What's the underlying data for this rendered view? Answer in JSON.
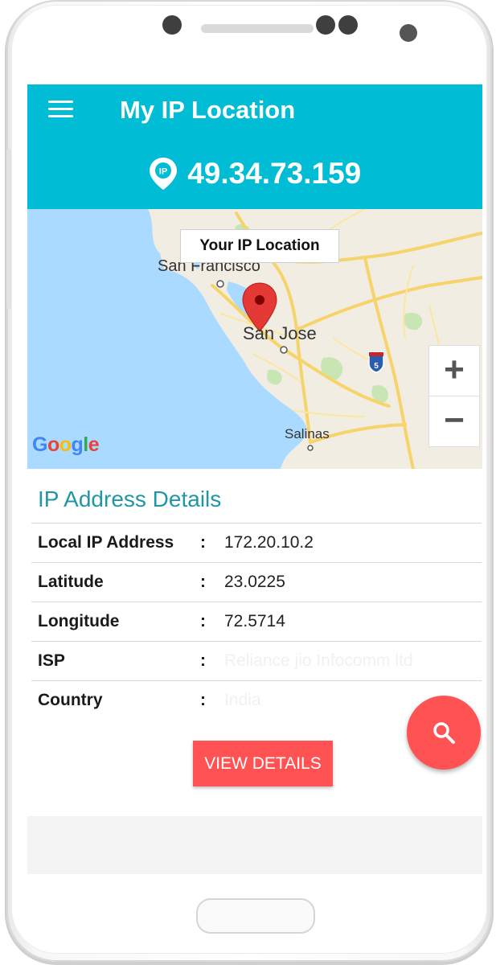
{
  "app": {
    "title": "My IP Location",
    "ip_address": "49.34.73.159",
    "accent_color": "#00bcd4",
    "action_color": "#ff5252"
  },
  "map": {
    "tooltip": "Your IP Location",
    "city_labels": [
      "San Francisco",
      "San Jose",
      "Salinas"
    ],
    "highway_shield": "5",
    "zoom_in": "+",
    "zoom_out": "−",
    "attribution": "Google"
  },
  "details": {
    "heading": "IP Address Details",
    "rows": [
      {
        "label": "Local IP Address",
        "sep": ":",
        "value": "172.20.10.2"
      },
      {
        "label": "Latitude",
        "sep": ":",
        "value": "23.0225"
      },
      {
        "label": "Longitude",
        "sep": ":",
        "value": "72.5714"
      },
      {
        "label": "ISP",
        "sep": ":",
        "value": "Reliance jio Infocomm ltd"
      },
      {
        "label": "Country",
        "sep": ":",
        "value": "India"
      }
    ],
    "button": "VIEW DETAILS"
  },
  "icons": {
    "menu": "hamburger-menu-icon",
    "ip_pin": "ip-location-pin-icon",
    "map_marker": "map-marker-icon",
    "search": "search-icon"
  }
}
